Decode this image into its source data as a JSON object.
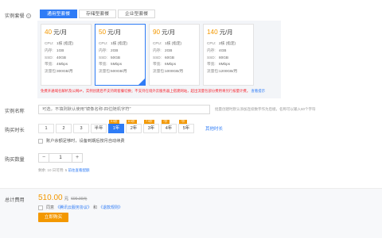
{
  "instance_plan": {
    "label": "实例套餐",
    "tabs": [
      "通用型套餐",
      "存储型套餐",
      "企业型套餐"
    ],
    "plans": [
      {
        "price": "40",
        "unit": "元/月",
        "cpu": "1核 (指定)",
        "ram": "1GB",
        "ssd": "40GB",
        "bw": "4Mbps",
        "traffic": "300GB/月"
      },
      {
        "price": "50",
        "unit": "元/月",
        "cpu": "1核 (指定)",
        "ram": "2GB",
        "ssd": "50GB",
        "bw": "5Mbps",
        "traffic": "500GB/月"
      },
      {
        "price": "90",
        "unit": "元/月",
        "cpu": "1核 (指定)",
        "ram": "2GB",
        "ssd": "60GB",
        "bw": "6Mbps",
        "traffic": "1000GB/月"
      },
      {
        "price": "140",
        "unit": "元/月",
        "cpu": "2核 (指定)",
        "ram": "4GB",
        "ssd": "80GB",
        "bw": "8Mbps",
        "traffic": "1200GB/月"
      }
    ],
    "keys": {
      "cpu": "CPU:",
      "ram": "内存:",
      "ssd": "SSD:",
      "bw": "带宽:",
      "traffic": "流量包:"
    },
    "note": "免费开通域名解析及公网IP，实例创建后不支持跨套餐切换；不支持在境外云服务器上搭建网站，超出流量包部分费用将另行按量计费。",
    "note_link": "查看提示"
  },
  "instance_name": {
    "label": "实例名称",
    "placeholder": "可选，不填则默认使用\"镜像名称-四位随机字符\"",
    "hint": "批量创建时默认添加连续数字作为后缀，名称可以输入60个字符"
  },
  "duration": {
    "label": "购买时长",
    "options": [
      {
        "label": "1",
        "badge": ""
      },
      {
        "label": "2",
        "badge": ""
      },
      {
        "label": "3",
        "badge": ""
      },
      {
        "label": "半年",
        "badge": ""
      },
      {
        "label": "1年",
        "badge": "9.5折"
      },
      {
        "label": "2年",
        "badge": "8.5折"
      },
      {
        "label": "3年",
        "badge": "7.5折"
      },
      {
        "label": "4年",
        "badge": "7折"
      },
      {
        "label": "5年",
        "badge": "7折"
      }
    ],
    "more": "其他时长",
    "autorenew": "账户余额足够时，设备到期后按月自动续费"
  },
  "quantity": {
    "label": "购买数量",
    "minus": "−",
    "value": "1",
    "plus": "+",
    "hint_prefix": "剩余: 10 日可用: 5",
    "hint_link": "前往查看配额"
  },
  "total": {
    "label": "总计费用",
    "amount": "510.00",
    "unit": "元",
    "original": "600.00元",
    "agree_prefix": "同意",
    "agree_link1": "《腾讯云服务协议》",
    "agree_and": "和",
    "agree_link2": "《退款规则》",
    "buy": "立即购买"
  },
  "colors": {
    "accent": "#2f7cf6",
    "price": "#f39800",
    "warning": "#f5222d"
  }
}
